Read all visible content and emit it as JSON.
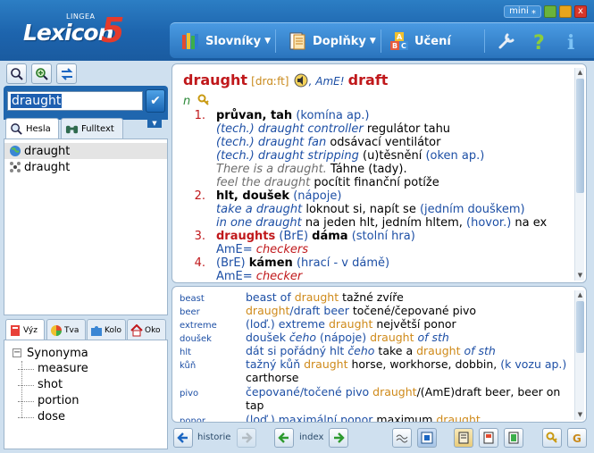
{
  "app": {
    "logo_small": "LINGEA",
    "logo_word": "Lexicon",
    "logo_number": "5",
    "mini_label": "mini",
    "close_glyph": "x"
  },
  "menu": [
    {
      "label": "Slovníky",
      "icon": "books-icon",
      "has_dropdown": true
    },
    {
      "label": "Doplňky",
      "icon": "addons-icon",
      "has_dropdown": true
    },
    {
      "label": "Učení",
      "icon": "abc-blocks-icon",
      "has_dropdown": false
    }
  ],
  "search": {
    "value": "draught"
  },
  "word_tabs": [
    {
      "label": "Hesla",
      "icon": "magnifier-icon",
      "active": true
    },
    {
      "label": "Fulltext",
      "icon": "binoculars-icon",
      "active": false
    }
  ],
  "word_list": [
    {
      "text": "draught",
      "icon": "globe-icon",
      "selected": true
    },
    {
      "text": "draught",
      "icon": "molecule-icon",
      "selected": false
    }
  ],
  "bottom_tabs": [
    {
      "label": "Výz",
      "icon": "notebook-icon",
      "active": true
    },
    {
      "label": "Tva",
      "icon": "shapes-icon",
      "active": false
    },
    {
      "label": "Kolo",
      "icon": "puzzle-icon",
      "active": false
    },
    {
      "label": "Oko",
      "icon": "house-icon",
      "active": false
    }
  ],
  "tree": {
    "root": "Synonyma",
    "expand_glyph": "−",
    "children": [
      "measure",
      "shot",
      "portion",
      "dose"
    ]
  },
  "entry": {
    "headword": "draught",
    "pronunciation": "[drɑːft]",
    "ame_label": ", AmE!",
    "ame_form": "draft",
    "pos": "n",
    "senses": [
      {
        "num": "1.",
        "lines": [
          [
            {
              "t": "průvan, tah",
              "c": "b"
            },
            {
              "t": " (komína ap.)",
              "c": "blue"
            }
          ],
          [
            {
              "t": "(tech.) ",
              "c": "bluei"
            },
            {
              "t": "draught controller",
              "c": "bluei"
            },
            {
              "t": "  regulátor tahu",
              "c": ""
            }
          ],
          [
            {
              "t": "(tech.) ",
              "c": "bluei"
            },
            {
              "t": "draught fan",
              "c": "bluei"
            },
            {
              "t": "  odsávací ventilátor",
              "c": ""
            }
          ],
          [
            {
              "t": "(tech.) ",
              "c": "bluei"
            },
            {
              "t": "draught stripping",
              "c": "bluei"
            },
            {
              "t": "  (u)těsnění ",
              "c": ""
            },
            {
              "t": "(oken ap.)",
              "c": "blue"
            }
          ],
          [
            {
              "t": "There is a draught.",
              "c": "grey"
            },
            {
              "t": "  Táhne (tady).",
              "c": ""
            }
          ],
          [
            {
              "t": "feel the draught",
              "c": "grey"
            },
            {
              "t": "  pocítit finanční potíže",
              "c": ""
            }
          ]
        ]
      },
      {
        "num": "2.",
        "lines": [
          [
            {
              "t": "hlt, doušek",
              "c": "b"
            },
            {
              "t": " (nápoje)",
              "c": "blue"
            }
          ],
          [
            {
              "t": "take a draught",
              "c": "bluei"
            },
            {
              "t": "  loknout si, napít se ",
              "c": ""
            },
            {
              "t": "(jedním douškem)",
              "c": "blue"
            }
          ],
          [
            {
              "t": "in one draught",
              "c": "bluei"
            },
            {
              "t": "  na jeden hlt, jedním hltem, ",
              "c": ""
            },
            {
              "t": "(hovor.)",
              "c": "blue"
            },
            {
              "t": " na ex",
              "c": ""
            }
          ]
        ]
      },
      {
        "num": "3.",
        "lines": [
          [
            {
              "t": "draughts",
              "c": "b red"
            },
            {
              "t": " (BrE) ",
              "c": "blue"
            },
            {
              "t": " dáma",
              "c": "b"
            },
            {
              "t": " (stolní hra)",
              "c": "blue"
            }
          ],
          [
            {
              "t": "AmE= ",
              "c": "blue"
            },
            {
              "t": "checkers",
              "c": "redi"
            }
          ]
        ]
      },
      {
        "num": "4.",
        "lines": [
          [
            {
              "t": "(BrE) ",
              "c": "blue"
            },
            {
              "t": " kámen",
              "c": "b"
            },
            {
              "t": " (hrací - v dámě)",
              "c": "blue"
            }
          ],
          [
            {
              "t": "AmE= ",
              "c": "blue"
            },
            {
              "t": "checker",
              "c": "redi"
            }
          ]
        ]
      }
    ]
  },
  "examples": [
    {
      "label": "beast",
      "parts": [
        {
          "t": "beast of ",
          "c": "blue"
        },
        {
          "t": "draught",
          "c": "orange"
        },
        {
          "t": "  tažné zvíře",
          "c": ""
        }
      ]
    },
    {
      "label": "beer",
      "parts": [
        {
          "t": "draught",
          "c": "orange"
        },
        {
          "t": "/draft beer",
          "c": "blue"
        },
        {
          "t": "  točené/čepované pivo",
          "c": ""
        }
      ]
    },
    {
      "label": "extreme",
      "parts": [
        {
          "t": "(loď.) ",
          "c": "blue"
        },
        {
          "t": "extreme ",
          "c": "blue"
        },
        {
          "t": "draught",
          "c": "orange"
        },
        {
          "t": "  největší ponor",
          "c": ""
        }
      ]
    },
    {
      "label": "doušek",
      "parts": [
        {
          "t": "doušek ",
          "c": "blue"
        },
        {
          "t": "čeho",
          "c": "bluei"
        },
        {
          "t": " (nápoje)  ",
          "c": "blue"
        },
        {
          "t": "draught",
          "c": "orange"
        },
        {
          "t": " of sth",
          "c": "bluei"
        }
      ]
    },
    {
      "label": "hlt",
      "parts": [
        {
          "t": "dát si pořádný hlt ",
          "c": "blue"
        },
        {
          "t": "čeho",
          "c": "bluei"
        },
        {
          "t": "  take a ",
          "c": ""
        },
        {
          "t": "draught",
          "c": "orange"
        },
        {
          "t": " of sth",
          "c": "bluei"
        }
      ]
    },
    {
      "label": "kůň",
      "parts": [
        {
          "t": "tažný kůň  ",
          "c": "blue"
        },
        {
          "t": "draught",
          "c": "orange"
        },
        {
          "t": " horse, workhorse, dobbin, ",
          "c": ""
        },
        {
          "t": "(k vozu ap.)",
          "c": "blue"
        },
        {
          "t": " carthorse",
          "c": ""
        }
      ]
    },
    {
      "label": "pivo",
      "parts": [
        {
          "t": "čepované/točené pivo  ",
          "c": "blue"
        },
        {
          "t": "draught",
          "c": "orange"
        },
        {
          "t": "/(AmE)draft beer, beer on tap",
          "c": ""
        }
      ]
    },
    {
      "label": "ponor",
      "parts": [
        {
          "t": "(loď.) maximální ponor",
          "c": "blue"
        },
        {
          "t": "  maximum ",
          "c": ""
        },
        {
          "t": "draught",
          "c": "orange"
        }
      ]
    }
  ],
  "bottom_bar": {
    "history_label": "historie",
    "index_label": "index"
  }
}
